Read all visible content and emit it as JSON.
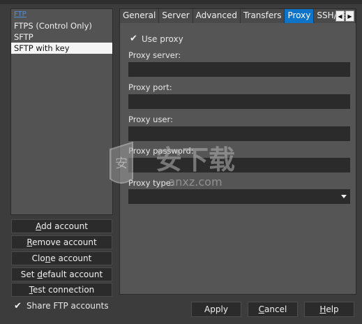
{
  "accounts": {
    "items": [
      {
        "label": "FTP"
      },
      {
        "label": "FTPS (Control Only)"
      },
      {
        "label": "SFTP"
      },
      {
        "label": "SFTP with key"
      }
    ]
  },
  "left_buttons": {
    "add_prefix": "",
    "add_ul": "A",
    "add_rest": "dd account",
    "remove_prefix": "",
    "remove_ul": "R",
    "remove_rest": "emove account",
    "clone_prefix": "Clo",
    "clone_ul": "n",
    "clone_rest": "e account",
    "setdefault_prefix": "Set ",
    "setdefault_ul": "d",
    "setdefault_rest": "efault account",
    "test_prefix": "",
    "test_ul": "T",
    "test_rest": "est connection"
  },
  "share": {
    "label": "Share FTP accounts",
    "checked": true
  },
  "tabs": [
    {
      "label": "General"
    },
    {
      "label": "Server"
    },
    {
      "label": "Advanced"
    },
    {
      "label": "Transfers"
    },
    {
      "label": "Proxy"
    },
    {
      "label": "SSH/SSL"
    }
  ],
  "proxy": {
    "use_proxy_label": "Use proxy",
    "use_proxy_checked": true,
    "server_label": "Proxy server:",
    "server_value": "",
    "port_label": "Proxy port:",
    "port_value": "",
    "user_label": "Proxy user:",
    "user_value": "",
    "password_label": "Proxy password:",
    "password_value": "",
    "type_label": "Proxy type:",
    "type_value": ""
  },
  "bottom_buttons": {
    "apply": "Apply",
    "cancel_ul": "C",
    "cancel_rest": "ancel",
    "help_ul": "H",
    "help_rest": "elp"
  },
  "watermark": {
    "text": "安下载",
    "sub": "anxz.com"
  },
  "colors": {
    "active_tab": "#0e74c8",
    "link": "#4f8fd8",
    "panel": "#555555",
    "input": "#2b2b2b"
  }
}
